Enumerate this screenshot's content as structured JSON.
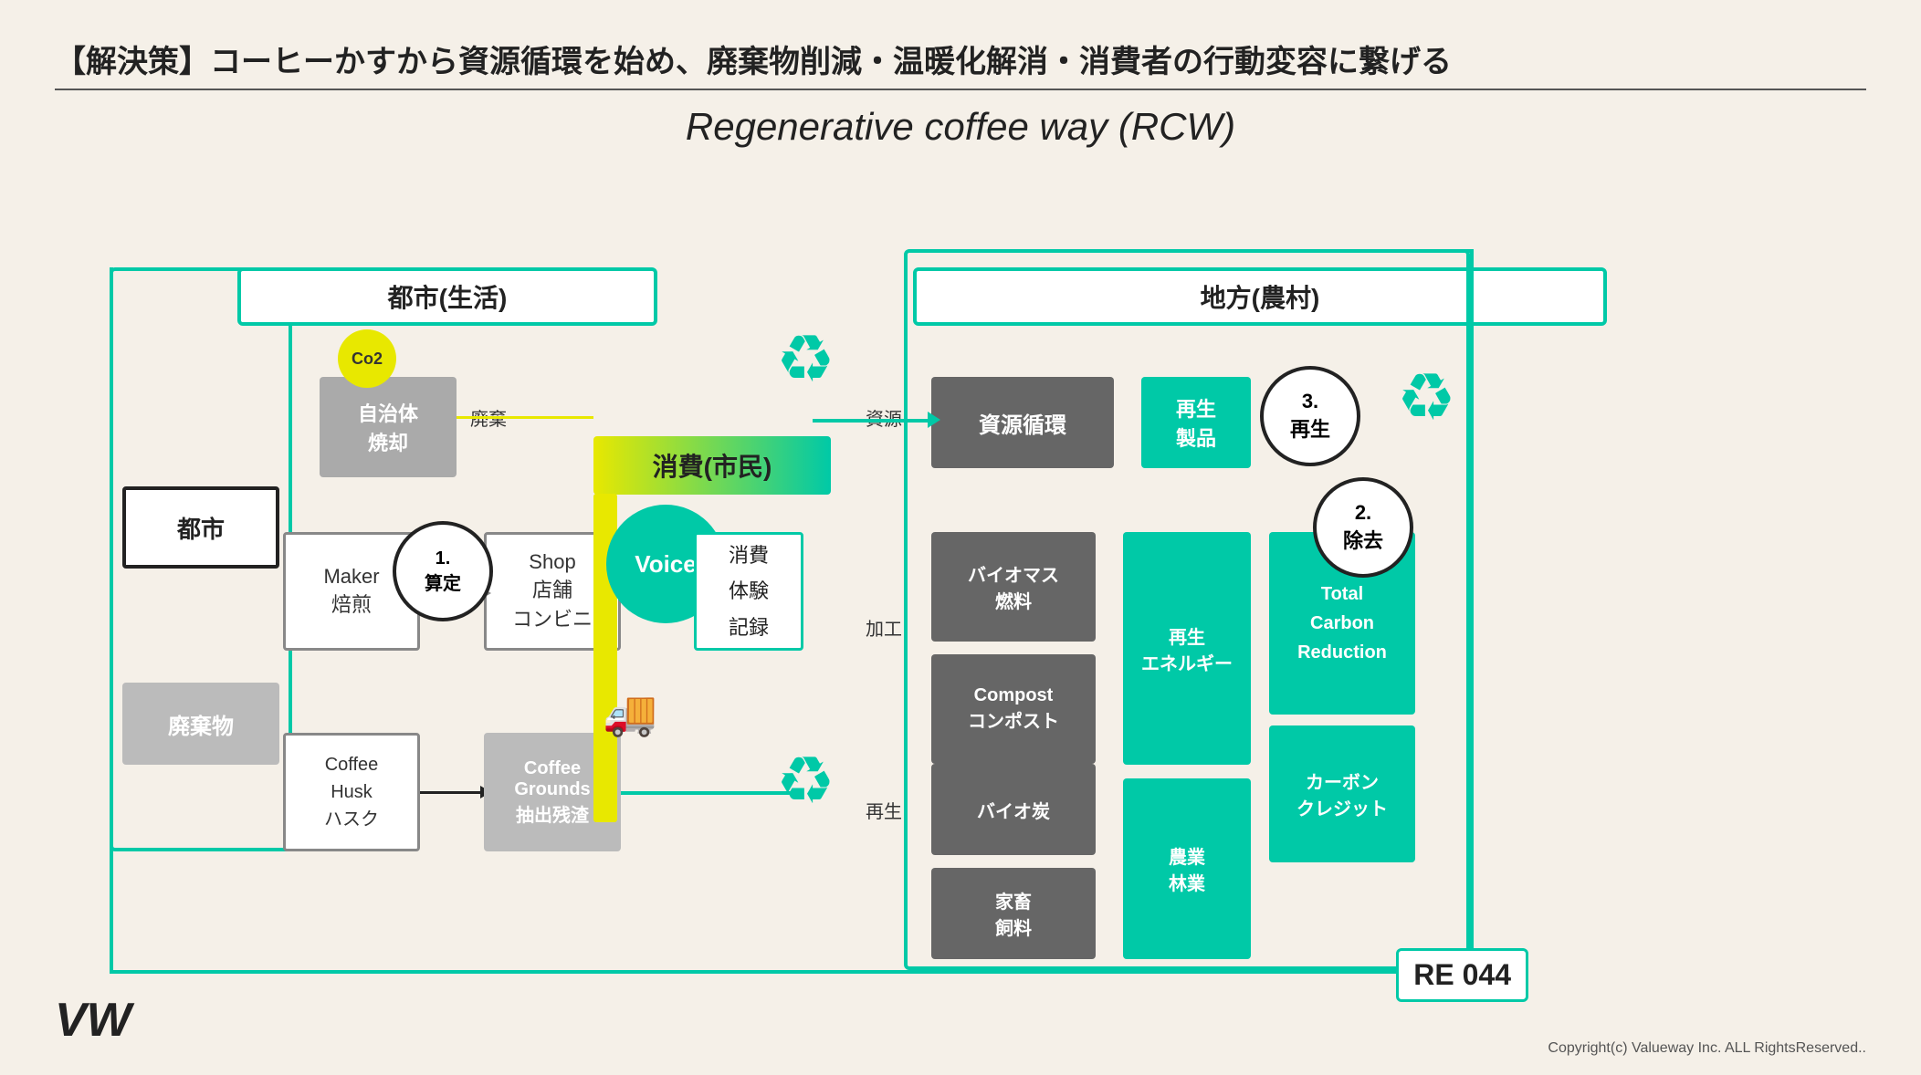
{
  "header": {
    "title": "【解決策】コーヒーかすから資源循環を始め、廃棄物削減・温暖化解消・消費者の行動変容に繋げる",
    "subtitle": "Regenerative coffee  way  (RCW)"
  },
  "regions": {
    "city": "都市(生活)",
    "rural": "地方(農村)"
  },
  "nodes": {
    "city_box": "都市",
    "waste_box": "廃棄物",
    "maker_box": "Maker\n焙煎",
    "shop_box": "Shop\n店舗\nコンビニ",
    "jichitai": "自治体\n焼却",
    "co2_label": "Co2",
    "waste_label": "廃棄",
    "shigen_label": "資源",
    "kako_label": "加工",
    "sasei_label": "再生",
    "coffee_husk": "Coffee\nHusk\nハスク",
    "coffee_grounds": "Coffee\nGrounds\n抽出残渣",
    "consumption_header": "消費(市民)",
    "voice": "Voice",
    "consumption_detail": "消費\n体験\n記録",
    "shigen_junkan": "資源循環",
    "sasei_seihin": "再生\n製品",
    "biomass": "バイオマス\n燃料",
    "compost": "Compost\nコンポスト",
    "bio_char": "バイオ炭",
    "animal_feed": "家畜\n飼料",
    "sasei_energy": "再生\nエネルギー",
    "agriculture": "農業\n林業",
    "total_carbon": "Total\nCarbon\nReduction",
    "carbon_credit": "カーボン\nクレジット",
    "circle1": "1.\n算定",
    "circle2": "2.\n除去",
    "circle3": "3.\n再生"
  },
  "footer": {
    "copyright": "Copyright(c) Valueway Inc. ALL RightsReserved..",
    "logo": "VW",
    "badge": "RE 044"
  }
}
